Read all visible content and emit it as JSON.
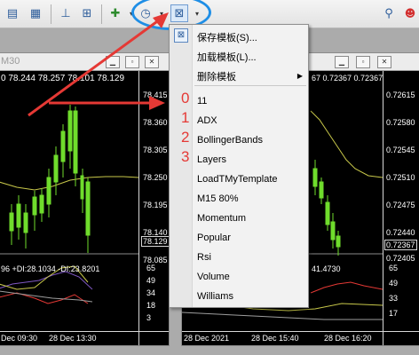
{
  "left_chart": {
    "title": "M30",
    "ohlc": "0  78.244  78.257  78.101  78.129",
    "price_labels": [
      "78.415",
      "78.360",
      "78.305",
      "78.250",
      "78.195",
      "78.140",
      "78.085"
    ],
    "bid_label": "78.129",
    "indicator_text": "96 +DI:28.1034 -DI:23.8201",
    "indicator_levels": [
      "65",
      "49",
      "34",
      "18",
      "3"
    ],
    "time_labels": [
      "Dec 09:30",
      "28 Dec 13:30"
    ]
  },
  "right_chart": {
    "ohlc": "67  0.72367  0.72367",
    "price_labels": [
      "0.72615",
      "0.72580",
      "0.72545",
      "0.72510",
      "0.72475",
      "0.72440",
      "0.72405"
    ],
    "bid_label": "0.72367",
    "indicator_text": "41.4730",
    "indicator_levels": [
      "65",
      "49",
      "33",
      "17"
    ],
    "time_labels": [
      "28 Dec 2021",
      "28 Dec 15:40",
      "28 Dec 16:20"
    ]
  },
  "template_menu": {
    "save": "保存模板(S)...",
    "load": "加载模板(L)...",
    "delete": "删除模板",
    "templates": [
      "11",
      "ADX",
      "BollingerBands",
      "Layers",
      "LoadTMyTemplate",
      "M15 80%",
      "Momentum",
      "Popular",
      "Rsi",
      "Volume",
      "Williams"
    ]
  },
  "annotations": [
    "0",
    "1",
    "2",
    "3"
  ],
  "colors": {
    "annotation_red": "#e53935",
    "highlight_ring": "#1e8ee6",
    "candle_green": "#6fdc2c"
  }
}
